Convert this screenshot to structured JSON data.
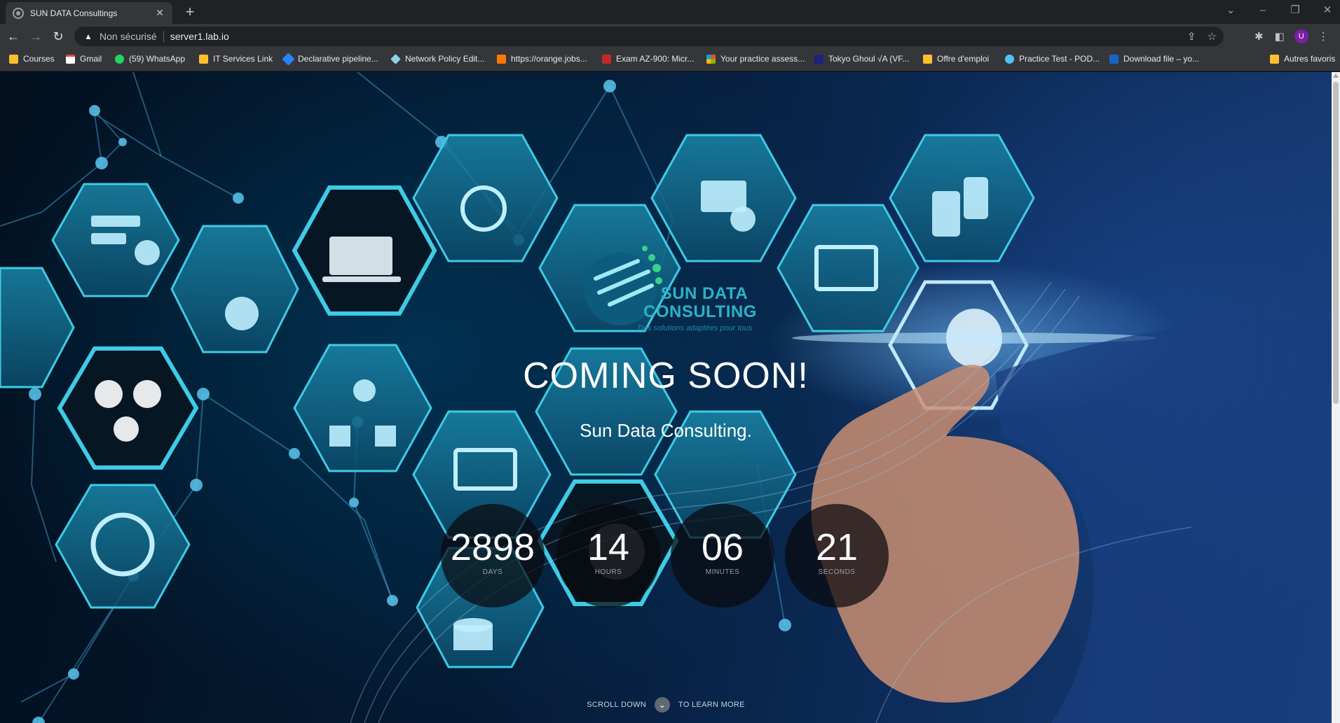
{
  "browser": {
    "tab_title": "SUN DATA Consultings",
    "tab_close": "✕",
    "new_tab": "+",
    "security_label": "Non sécurisé",
    "url": "server1.lab.io",
    "avatar_letter": "U",
    "bookmarks": [
      {
        "label": "Courses",
        "icon": "folder-icon"
      },
      {
        "label": "Gmail",
        "icon": "gmail-icon"
      },
      {
        "label": "(59) WhatsApp",
        "icon": "whatsapp-icon"
      },
      {
        "label": "IT Services Link",
        "icon": "folder-icon"
      },
      {
        "label": "Declarative pipeline...",
        "icon": "jira-icon"
      },
      {
        "label": "Network Policy Edit...",
        "icon": "cilium-icon"
      },
      {
        "label": "https://orange.jobs...",
        "icon": "orange-icon"
      },
      {
        "label": "Exam AZ-900: Micr...",
        "icon": "examtopics-icon"
      },
      {
        "label": "Your practice assess...",
        "icon": "microsoft-icon"
      },
      {
        "label": "Tokyo Ghoul √A (VF...",
        "icon": "anime-icon"
      },
      {
        "label": "Offre d'emploi",
        "icon": "folder-icon"
      },
      {
        "label": "Practice Test - POD...",
        "icon": "cloud-icon"
      },
      {
        "label": "Download file – yo...",
        "icon": "download-icon"
      }
    ],
    "other_bookmarks": "Autres favoris"
  },
  "page": {
    "brand_line1": "SUN DATA",
    "brand_line2": "CONSULTING",
    "brand_tagline": "Des solutions adaptées pour tous",
    "headline": "COMING SOON!",
    "subline": "Sun Data Consulting.",
    "countdown": [
      {
        "value": "2898",
        "label": "DAYS"
      },
      {
        "value": "14",
        "label": "HOURS"
      },
      {
        "value": "06",
        "label": "MINUTES"
      },
      {
        "value": "21",
        "label": "SECONDS"
      }
    ],
    "scroll_left": "SCROLL DOWN",
    "scroll_right": "TO LEARN MORE"
  },
  "colors": {
    "accent": "#2bb3c7",
    "hex_fill": "#0e5e7e",
    "hex_stroke": "#3ecbe6"
  }
}
